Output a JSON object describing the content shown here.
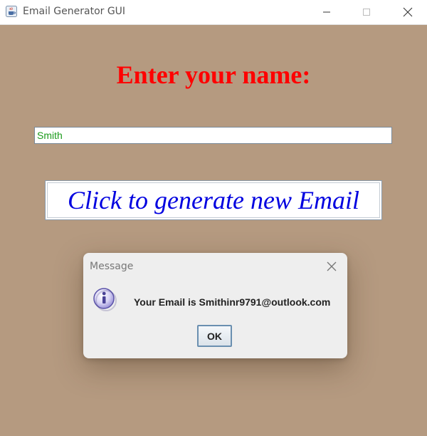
{
  "window": {
    "title": "Email Generator GUI",
    "icon": "java-coffee-icon"
  },
  "main": {
    "heading": "Enter your name:",
    "name_value": "Smith",
    "generate_button_label": "Click to generate new Email"
  },
  "dialog": {
    "title": "Message",
    "icon": "info-icon",
    "message": "Your Email is Smithinr9791@outlook.com",
    "ok_label": "OK"
  },
  "colors": {
    "background": "#b59a80",
    "heading": "#ff0000",
    "button_text": "#0000e0",
    "input_text": "#1a9a1a"
  }
}
